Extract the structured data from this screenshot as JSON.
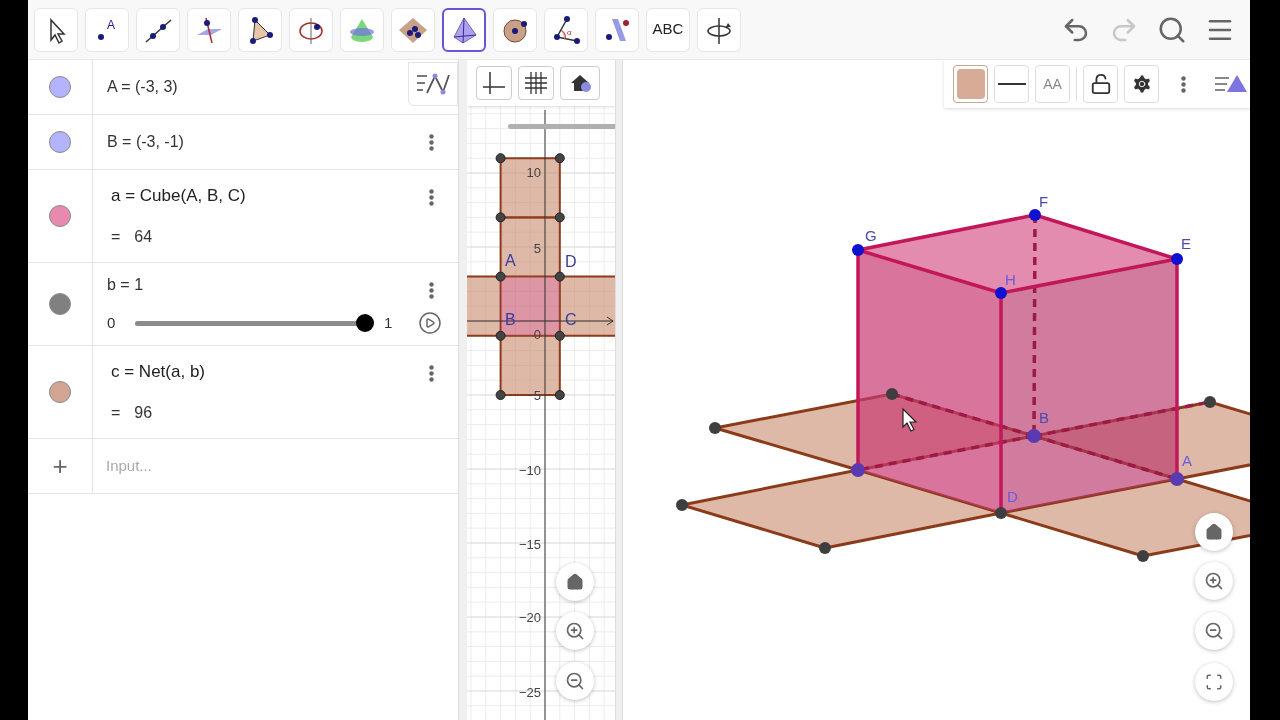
{
  "toolbar": {
    "tools": [
      {
        "kind": "move",
        "selected": false
      },
      {
        "kind": "point",
        "label": "A",
        "selected": false
      },
      {
        "kind": "line",
        "selected": false
      },
      {
        "kind": "perpendicular",
        "selected": false
      },
      {
        "kind": "polygon",
        "selected": false
      },
      {
        "kind": "circle-axis",
        "selected": false
      },
      {
        "kind": "cone",
        "selected": false
      },
      {
        "kind": "plane",
        "selected": false
      },
      {
        "kind": "pyramid",
        "selected": true
      },
      {
        "kind": "sphere",
        "selected": false
      },
      {
        "kind": "angle",
        "label": "α",
        "selected": false
      },
      {
        "kind": "reflect",
        "selected": false
      },
      {
        "kind": "text",
        "label": "ABC",
        "selected": false
      },
      {
        "kind": "rotate",
        "selected": false
      }
    ],
    "actions": [
      {
        "kind": "undo",
        "disabled": false
      },
      {
        "kind": "redo",
        "disabled": true
      },
      {
        "kind": "search",
        "disabled": false
      },
      {
        "kind": "menu",
        "disabled": false
      }
    ]
  },
  "algebra": {
    "items": [
      {
        "kind": "point",
        "color": "#b3b3ff",
        "definition": "A = (-3, 3)",
        "menu_button": false
      },
      {
        "kind": "point",
        "color": "#b3b3ff",
        "definition": "B = (-3, -1)",
        "menu_button": true
      },
      {
        "kind": "expression",
        "color": "#e88ab0",
        "definition": "a = Cube(A, B, C)",
        "result_sign": "=",
        "result": "64",
        "menu_button": true
      },
      {
        "kind": "slider",
        "color": "#808080",
        "definition": "b = 1",
        "min": "0",
        "max": "1",
        "level": 1,
        "menu_button": true
      },
      {
        "kind": "expression",
        "color": "#d3a693",
        "definition": "c = Net(a, b)",
        "result_sign": "=",
        "result": "96",
        "menu_button": true
      }
    ],
    "input": {
      "plus": "+",
      "placeholder": "Input..."
    }
  },
  "graphics_2d": {
    "tick_labels": [
      "10",
      "5",
      "0",
      "−5",
      "−10",
      "−15",
      "−20",
      "−25"
    ],
    "point_labels": [
      "A",
      "D",
      "B",
      "C"
    ]
  },
  "graphics_3d": {
    "style_bar": {
      "text_style": "AA"
    },
    "point_labels": [
      "G",
      "F",
      "E",
      "H",
      "B",
      "A",
      "D"
    ]
  }
}
